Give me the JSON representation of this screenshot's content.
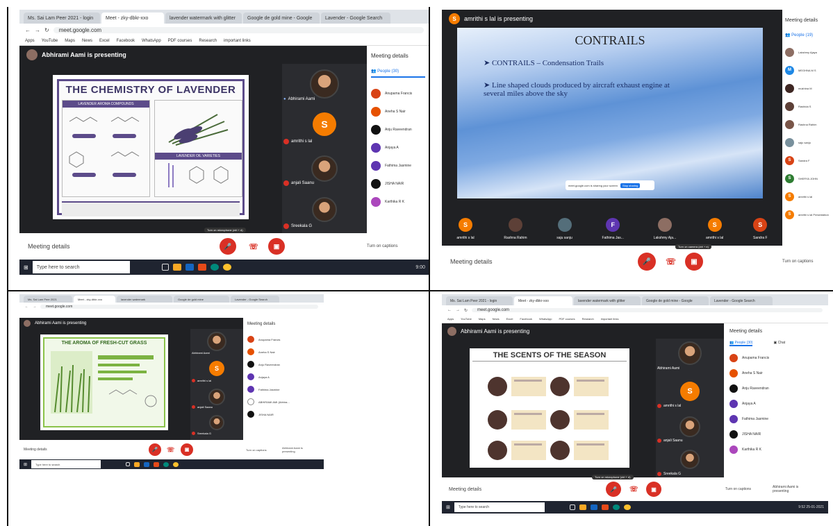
{
  "q1": {
    "tabs": [
      "Ms. Sai Lam Peer 2021 - login",
      "Meet - zky-dbkr-xxo",
      "lavender watermark with glitter",
      "Google de gold mine - Google",
      "Lavender - Google Search"
    ],
    "url": "meet.google.com",
    "bookmarks": [
      "Apps",
      "YouTube",
      "Maps",
      "News",
      "Excel",
      "Facebook",
      "WhatsApp",
      "PDF courses",
      "Research",
      "important links"
    ],
    "presenter": "Abhirami Aami is presenting",
    "slide_title": "THE CHEMISTRY OF LAVENDER",
    "slide_box_left": "LAVENDER AROMA COMPOUNDS",
    "slide_box_right": "LAVENDER OIL VARIETIES",
    "tiles": [
      {
        "name": "Abhirami Aami",
        "type": "face"
      },
      {
        "name": "amrithi s lal",
        "type": "letter",
        "letter": "S",
        "color": "#f57c00"
      },
      {
        "name": "anjali Saanu",
        "type": "face"
      },
      {
        "name": "Sreekala G",
        "type": "face"
      }
    ],
    "panel_title": "Meeting details",
    "people_label": "People (30)",
    "people": [
      {
        "name": "Anupama Francis",
        "color": "#d84315"
      },
      {
        "name": "Aneha S Nair",
        "color": "#e65100"
      },
      {
        "name": "Anju Raveendran",
        "color": "#111111"
      },
      {
        "name": "Anjaya A",
        "color": "#5e35b1"
      },
      {
        "name": "Fathima Jasmine",
        "color": "#5e35b1"
      },
      {
        "name": "JISHA NAIR",
        "color": "#111111"
      },
      {
        "name": "Karthika R K",
        "color": "#ab47bc"
      }
    ],
    "tooltip": "Turn on microphone (ctrl + d)",
    "details": "Meeting details",
    "captions": "Turn on captions",
    "taskbar_search": "Type here to search",
    "time": "9:00"
  },
  "q2": {
    "presenter": "amrithi s lal is presenting",
    "slide_title": "CONTRAILS",
    "bullet1": "CONTRAILS – Condensation Trails",
    "bullet2": "Line shaped clouds produced by aircraft exhaust engine at several miles above the sky",
    "share_bar": "meet.google.com is sharing your screen",
    "share_btn": "Stop sharing",
    "bottom_tiles": [
      {
        "name": "amrithi s lal",
        "letter": "S",
        "color": "#f57c00"
      },
      {
        "name": "Rashna Rahim",
        "letter": "",
        "color": "#5d4037"
      },
      {
        "name": "saju sanju",
        "letter": "",
        "color": "#546e7a"
      },
      {
        "name": "Fathima Jas...",
        "letter": "F",
        "color": "#5e35b1"
      },
      {
        "name": "Lakshmy Aja...",
        "letter": "",
        "color": "#8d6e63"
      },
      {
        "name": "amrithi s lal",
        "letter": "S",
        "color": "#f57c00"
      },
      {
        "name": "Sandra F",
        "letter": "S",
        "color": "#d84315"
      }
    ],
    "panel_title": "Meeting details",
    "people_label": "People (19)",
    "people": [
      {
        "name": "Lakshmy Ajaya",
        "color": "#8d6e63",
        "letter": ""
      },
      {
        "name": "MEGHNA M S",
        "color": "#1e88e5",
        "letter": "M"
      },
      {
        "name": "mukhina M",
        "color": "#3e2723",
        "letter": ""
      },
      {
        "name": "Rashida S",
        "color": "#5d4037",
        "letter": ""
      },
      {
        "name": "Rashna Rahim",
        "color": "#795548",
        "letter": ""
      },
      {
        "name": "saju sanju",
        "color": "#78909c",
        "letter": ""
      },
      {
        "name": "Sandra F",
        "color": "#d84315",
        "letter": "S"
      },
      {
        "name": "SHERYA JOHN",
        "color": "#2e7d32",
        "letter": "S"
      },
      {
        "name": "amrithi s lal",
        "color": "#f57c00",
        "letter": "S"
      },
      {
        "name": "amrithi s lal Presentation",
        "color": "#f57c00",
        "letter": "S"
      }
    ],
    "tooltip": "Turn on camera (ctrl + e)",
    "details": "Meeting details",
    "captions": "Turn on captions"
  },
  "q3": {
    "tabs": [
      "Ms. Sai Lam Peer 2021",
      "Meet - zky-dbkr-xxo",
      "lavender watermark",
      "Google de gold mine",
      "Lavender - Google Search"
    ],
    "url": "meet.google.com",
    "presenter": "Abhirami Aami is presenting",
    "slide_title": "THE AROMA OF FRESH-CUT GRASS",
    "tiles": [
      {
        "name": "Abhirami Aami",
        "type": "face"
      },
      {
        "name": "amrithi s lal",
        "type": "letter",
        "letter": "S",
        "color": "#f57c00"
      },
      {
        "name": "anjali Saanu",
        "type": "face"
      },
      {
        "name": "Sreekala G",
        "type": "face"
      }
    ],
    "panel_title": "Meeting details",
    "people": [
      {
        "name": "Anupama Francis",
        "color": "#d84315"
      },
      {
        "name": "Aneha S Nair",
        "color": "#e65100"
      },
      {
        "name": "Anju Raveendran",
        "color": "#111111"
      },
      {
        "name": "Anjaya A",
        "color": "#5e35b1"
      },
      {
        "name": "Fathima Jasmine",
        "color": "#5e35b1"
      },
      {
        "name": "ABHIRAMI AMI (Abhira...",
        "color": "#ffffff"
      },
      {
        "name": "JISHA NAIR",
        "color": "#111111"
      }
    ],
    "details": "Meeting details",
    "captions": "Turn on captions",
    "present": "Abhirami Aami is presenting",
    "taskbar_search": "Type here to search"
  },
  "q4": {
    "tabs": [
      "Ms. Sai Lam Peer 2021 - login",
      "Meet - zky-dbkr-xxo",
      "lavender watermark with glitter",
      "Google de gold mine - Google",
      "Lavender - Google Search"
    ],
    "url": "meet.google.com",
    "bookmarks": [
      "Apps",
      "YouTube",
      "Maps",
      "News",
      "Excel",
      "Facebook",
      "WhatsApp",
      "PDF courses",
      "Research",
      "important links"
    ],
    "presenter": "Abhirami Aami is presenting",
    "slide_title": "THE SCENTS OF THE SEASON",
    "tiles": [
      {
        "name": "Abhirami Aami",
        "type": "face"
      },
      {
        "name": "amrithi s lal",
        "type": "letter",
        "letter": "S",
        "color": "#f57c00"
      },
      {
        "name": "anjali Saanu",
        "type": "face"
      },
      {
        "name": "Sreekala G",
        "type": "face"
      }
    ],
    "panel_title": "Meeting details",
    "people_label": "People (30)",
    "chat_label": "Chat",
    "people": [
      {
        "name": "Anupama Francis",
        "color": "#d84315"
      },
      {
        "name": "Aneha S Nair",
        "color": "#e65100"
      },
      {
        "name": "Anju Raveendran",
        "color": "#111111"
      },
      {
        "name": "Anjaya A",
        "color": "#5e35b1"
      },
      {
        "name": "Fathima Jasmine",
        "color": "#5e35b1"
      },
      {
        "name": "JISHA NAIR",
        "color": "#111111"
      },
      {
        "name": "Karthika R K",
        "color": "#ab47bc"
      }
    ],
    "tooltip": "Turn on microphone (ctrl + d)",
    "details": "Meeting details",
    "captions": "Turn on captions",
    "present": "Abhirami Aami is presenting",
    "taskbar_search": "Type here to search",
    "time": "9:52 25-01-2021"
  }
}
